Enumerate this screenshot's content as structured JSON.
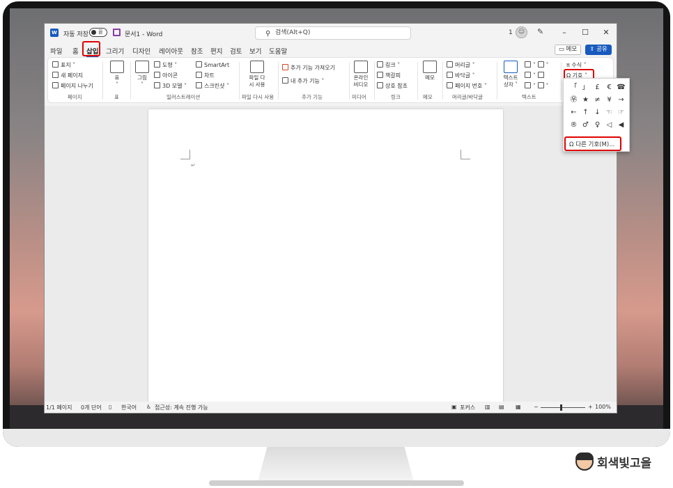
{
  "titlebar": {
    "autosave_label": "자동 저장",
    "autosave_state": "끔",
    "doc_title": "문서1 - Word",
    "search_placeholder": "검색(Alt+Q)",
    "user_count": "1"
  },
  "menu": [
    "파일",
    "홈",
    "삽입",
    "그리기",
    "디자인",
    "레이아웃",
    "참조",
    "편지",
    "검토",
    "보기",
    "도움말"
  ],
  "menu_active": "삽입",
  "actions": {
    "memo": "메모",
    "share": "공유"
  },
  "ribbon": {
    "page": {
      "items": [
        "표지",
        "새 페이지",
        "페이지 나누기"
      ],
      "label": "페이지"
    },
    "table": {
      "button": "표",
      "label": "표"
    },
    "illustrations": {
      "picture": "그림",
      "shapes": "도형",
      "icons": "아이콘",
      "model3d": "3D 모델",
      "smartart": "SmartArt",
      "chart": "차트",
      "screenshot": "스크린샷",
      "label": "일러스트레이션"
    },
    "reuse": {
      "button_line1": "파일 다",
      "button_line2": "시 사용",
      "label": "파일 다시 사용"
    },
    "addins": {
      "get": "추가 기능 가져오기",
      "my": "내 추가 기능",
      "label": "추가 기능"
    },
    "media": {
      "button_line1": "온라인",
      "button_line2": "비디오",
      "label": "미디어"
    },
    "links": {
      "link": "링크",
      "bookmark": "책갈피",
      "xref": "상호 참조",
      "label": "링크"
    },
    "comments": {
      "button": "메모",
      "label": "메모"
    },
    "header_footer": {
      "header": "머리글",
      "footer": "바닥글",
      "page_number": "페이지 번호",
      "label": "머리글/바닥글"
    },
    "text": {
      "textbox_line1": "텍스트",
      "textbox_line2": "상자",
      "label": "텍스트"
    },
    "symbols": {
      "equation": "수식",
      "symbol": "기호"
    }
  },
  "symbol_panel": {
    "symbols": [
      "「",
      "」",
      "£",
      "€",
      "☎",
      "㉾",
      "★",
      "≠",
      "¥",
      "→",
      "←",
      "↑",
      "↓",
      "☜",
      "☞",
      "®",
      "♂",
      "♀",
      "◁",
      "◀"
    ],
    "more": "다른 기호(M)..."
  },
  "statusbar": {
    "page": "1/1 페이지",
    "words": "0개 단어",
    "language": "한국어",
    "accessibility": "접근성: 계속 진행 가능",
    "focus": "포커스",
    "zoom": "100%"
  },
  "brand": "회색빛고을",
  "colors": {
    "accent": "#185abd",
    "highlight": "#e00000"
  }
}
